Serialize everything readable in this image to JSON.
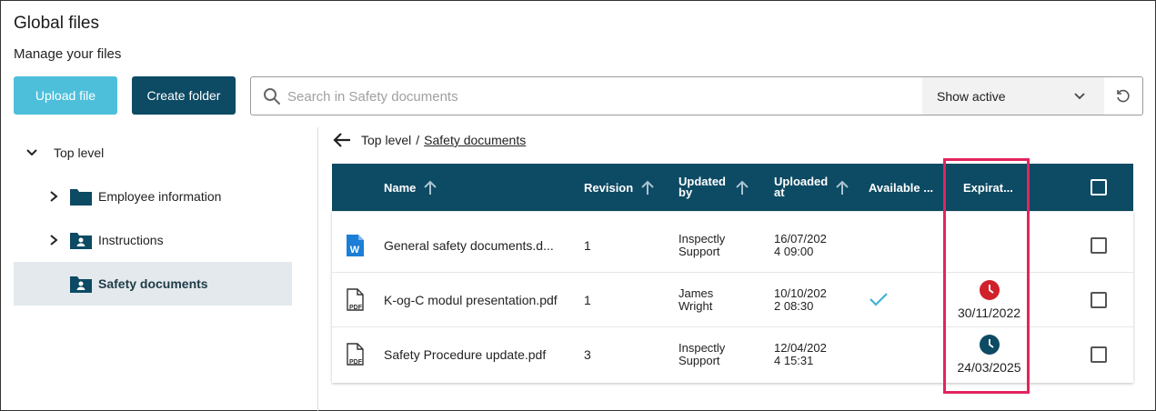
{
  "page": {
    "title": "Global files",
    "subtitle": "Manage your files"
  },
  "toolbar": {
    "upload_label": "Upload file",
    "create_folder_label": "Create folder",
    "search_placeholder": "Search in Safety documents",
    "filter_value": "Show active"
  },
  "tree": {
    "root": "Top level",
    "items": [
      {
        "label": "Employee information",
        "icon": "folder-icon"
      },
      {
        "label": "Instructions",
        "icon": "shared-folder-icon"
      },
      {
        "label": "Safety documents",
        "icon": "shared-folder-icon",
        "selected": true
      }
    ]
  },
  "breadcrumb": {
    "root": "Top level",
    "separator": "/",
    "current": "Safety documents"
  },
  "table": {
    "columns": {
      "name": "Name",
      "revision": "Revision",
      "updated_by_1": "Updated",
      "updated_by_2": "by",
      "uploaded_at_1": "Uploaded",
      "uploaded_at_2": "at",
      "available": "Available ...",
      "expiration": "Expirat..."
    },
    "rows": [
      {
        "icon": "word-file-icon",
        "name": "General safety documents.d...",
        "revision": "1",
        "updated_by_1": "Inspectly",
        "updated_by_2": "Support",
        "uploaded_1": "16/07/202",
        "uploaded_2": "4 09:00",
        "available": false,
        "expiration": ""
      },
      {
        "icon": "pdf-file-icon",
        "name": "K-og-C modul presentation.pdf",
        "revision": "1",
        "updated_by_1": "James",
        "updated_by_2": "Wright",
        "uploaded_1": "10/10/202",
        "uploaded_2": "2 08:30",
        "available": true,
        "expiration": "30/11/2022",
        "expiration_status": "expired"
      },
      {
        "icon": "pdf-file-icon",
        "name": "Safety Procedure update.pdf",
        "revision": "3",
        "updated_by_1": "Inspectly",
        "updated_by_2": "Support",
        "uploaded_1": "12/04/202",
        "uploaded_2": "4 15:31",
        "available": false,
        "expiration": "24/03/2025",
        "expiration_status": "active"
      }
    ]
  },
  "colors": {
    "primary_dark": "#0d4a63",
    "primary_light": "#4dbfdb",
    "expired_red": "#d0202a",
    "check_blue": "#3eb4d6",
    "highlight": "#e3245e"
  }
}
